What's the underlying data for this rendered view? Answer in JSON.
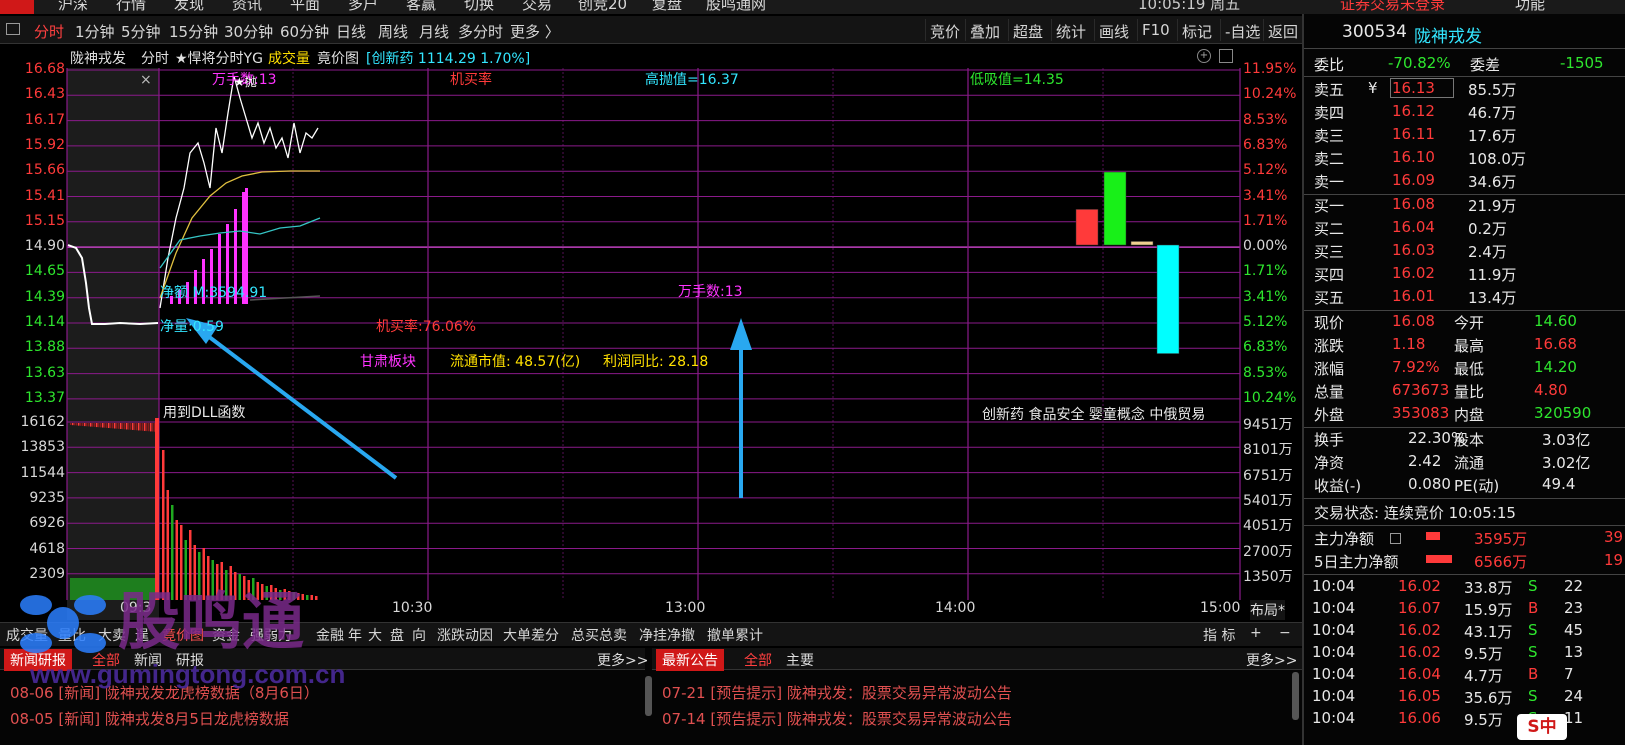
{
  "top_menu": {
    "items": [
      "沪深",
      "行情",
      "发现",
      "资讯",
      "平面",
      "多户",
      "客赢",
      "切换",
      "交易",
      "创竞20",
      "复盘",
      "股鸣通网"
    ],
    "login_status": "证券交易未登录",
    "clock": "10:05:19 周五",
    "function_label": "功能"
  },
  "toolbar": {
    "periods": [
      "分时",
      "1分钟",
      "5分钟",
      "15分钟",
      "30分钟",
      "60分钟",
      "日线",
      "周线",
      "月线",
      "多分时",
      "更多 〉"
    ],
    "right_buttons": [
      "竞价",
      "叠加",
      "超盘",
      "统计",
      "画线",
      "F10",
      "标记",
      "-自选",
      "返回"
    ]
  },
  "chart_header": {
    "stock_name": "陇神戎发",
    "view": "分时",
    "indicator": "★悍将分时YG",
    "sub1": "成交量",
    "sub2": "竟价图",
    "sector": "[创新药 1114.29 1.70%]"
  },
  "price_axis": {
    "left_prices": [
      "16.68",
      "16.43",
      "16.17",
      "15.92",
      "15.66",
      "15.41",
      "15.15",
      "14.90",
      "14.65",
      "14.39",
      "14.14",
      "13.88",
      "13.63",
      "13.37"
    ],
    "right_pcts": [
      "11.95%",
      "10.24%",
      "8.53%",
      "6.83%",
      "5.12%",
      "3.41%",
      "1.71%",
      "0.00%",
      "1.71%",
      "3.41%",
      "5.12%",
      "6.83%",
      "8.53%",
      "10.24%"
    ],
    "vol_left": [
      "16162",
      "13853",
      "11544",
      "9235",
      "6926",
      "4618",
      "2309"
    ],
    "vol_right": [
      "9451万",
      "8101万",
      "6751万",
      "5401万",
      "4051万",
      "2700万",
      "1350万"
    ],
    "time_labels": [
      "09:3",
      "10:30",
      "13:00",
      "14:00",
      "15:00"
    ],
    "layout_btn": "布局*"
  },
  "annotations": {
    "wan_shou_top": "万手数:13",
    "ji_mai_lv_top": "机买率",
    "gao_pao": "高抛值=16.37",
    "di_xi": "低吸值=14.35",
    "jing_e": "净额 M:3594.91",
    "jing_liang": "净量:0.59",
    "ji_mai_lv": "机买率:76.06%",
    "wan_shou_mid": "万手数:13",
    "region": "甘肃板块",
    "float_cap": "流通市值: 48.57(亿)",
    "profit_yoy": "利润同比: 28.18",
    "dll_note": "用到DLL函数",
    "concepts": "创新药 食品安全 婴童概念 中俄贸易",
    "star_label": "★抛"
  },
  "bottom_tabs": {
    "items": [
      "成交量",
      "量比",
      "大卖",
      "逞",
      "竟价图",
      "资金",
      "强弱力",
      "金融",
      "年",
      "大",
      "盘",
      "向",
      "涨跌动因",
      "大单差分",
      "总买总卖",
      "净挂净撤",
      "撤单累计"
    ],
    "active": "竟价图",
    "right": [
      "指 标",
      "+",
      "−"
    ]
  },
  "news_left": {
    "tabs": [
      "新闻研报",
      "全部",
      "新闻",
      "研报"
    ],
    "more": "更多>>",
    "rows": [
      "08-06 [新闻] 陇神戎发龙虎榜数据（8月6日）",
      "08-05 [新闻] 陇神戎发8月5日龙虎榜数据"
    ]
  },
  "news_right": {
    "tabs": [
      "最新公告",
      "全部",
      "主要"
    ],
    "more": "更多>>",
    "rows": [
      "07-21 [预告提示] 陇神戎发：股票交易异常波动公告",
      "07-14 [预告提示] 陇神戎发：股票交易异常波动公告"
    ]
  },
  "quote": {
    "code": "300534",
    "name": "陇神戎发",
    "wei_bi_label": "委比",
    "wei_bi": "-70.82%",
    "wei_cha_label": "委差",
    "wei_cha": "-1505",
    "asks": [
      {
        "label": "卖五",
        "price": "16.13",
        "vol": "85.5万"
      },
      {
        "label": "卖四",
        "price": "16.12",
        "vol": "46.7万"
      },
      {
        "label": "卖三",
        "price": "16.11",
        "vol": "17.6万"
      },
      {
        "label": "卖二",
        "price": "16.10",
        "vol": "108.0万"
      },
      {
        "label": "卖一",
        "price": "16.09",
        "vol": "34.6万"
      }
    ],
    "bids": [
      {
        "label": "买一",
        "price": "16.08",
        "vol": "21.9万"
      },
      {
        "label": "买二",
        "price": "16.04",
        "vol": "0.2万"
      },
      {
        "label": "买三",
        "price": "16.03",
        "vol": "2.4万"
      },
      {
        "label": "买四",
        "price": "16.02",
        "vol": "11.9万"
      },
      {
        "label": "买五",
        "price": "16.01",
        "vol": "13.4万"
      }
    ],
    "yen": "¥",
    "stats": [
      {
        "l1": "现价",
        "v1": "16.08",
        "l2": "今开",
        "v2": "14.60"
      },
      {
        "l1": "涨跌",
        "v1": "1.18",
        "l2": "最高",
        "v2": "16.68"
      },
      {
        "l1": "涨幅",
        "v1": "7.92%",
        "l2": "最低",
        "v2": "14.20"
      },
      {
        "l1": "总量",
        "v1": "673673",
        "l2": "量比",
        "v2": "4.80"
      },
      {
        "l1": "外盘",
        "v1": "353083",
        "l2": "内盘",
        "v2": "320590"
      }
    ],
    "stats2": [
      {
        "l1": "换手",
        "v1": "22.30%",
        "l2": "股本",
        "v2": "3.03亿"
      },
      {
        "l1": "净资",
        "v1": "2.42",
        "l2": "流通",
        "v2": "3.02亿"
      },
      {
        "l1": "收益(-)",
        "v1": "0.080",
        "l2": "PE(动)",
        "v2": "49.4"
      }
    ],
    "trade_status": "交易状态: 连续竞价 10:05:15",
    "main_net_label": "主力净额",
    "main_net": "3595万",
    "main_net_pct": "39",
    "main_net5_label": "5日主力净额",
    "main_net5": "6566万",
    "main_net5_pct": "19",
    "ticks": [
      {
        "t": "10:04",
        "p": "16.02",
        "v": "33.8万",
        "s": "S",
        "n": "22"
      },
      {
        "t": "10:04",
        "p": "16.07",
        "v": "15.9万",
        "s": "B",
        "n": "23"
      },
      {
        "t": "10:04",
        "p": "16.02",
        "v": "43.1万",
        "s": "S",
        "n": "45"
      },
      {
        "t": "10:04",
        "p": "16.02",
        "v": "9.5万",
        "s": "S",
        "n": "13"
      },
      {
        "t": "10:04",
        "p": "16.04",
        "v": "4.7万",
        "s": "B",
        "n": "7"
      },
      {
        "t": "10:04",
        "p": "16.05",
        "v": "35.6万",
        "s": "S",
        "n": "24"
      },
      {
        "t": "10:04",
        "p": "16.06",
        "v": "9.5万",
        "s": "S",
        "n": "11"
      }
    ]
  },
  "watermark": {
    "brand": "股鸣通",
    "url": "www.gumingtong.com.cn"
  },
  "colors": {
    "up": "#ff3a3a",
    "down": "#2ee62e",
    "grid": "#8a1a8a",
    "accent_cyan": "#33e6ff",
    "magenta": "#ff33ff"
  },
  "auction_bars": [
    {
      "dir": "up",
      "color": "red",
      "value": 2
    },
    {
      "dir": "up",
      "color": "green",
      "value": 4.1
    },
    {
      "dir": "up",
      "color": "tan",
      "value": 0.2
    },
    {
      "dir": "down",
      "color": "cyan",
      "value": 6.1
    }
  ]
}
